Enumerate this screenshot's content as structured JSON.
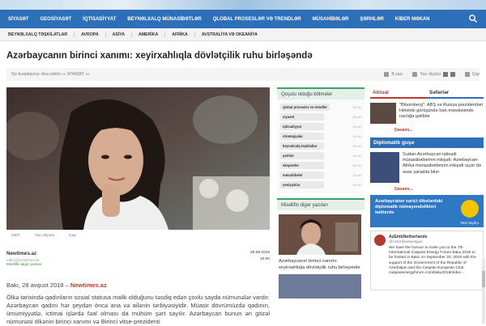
{
  "nav": {
    "items": [
      "SİYASƏT",
      "GEOSİYASƏT",
      "İQTİSADİYYAT",
      "BEYNƏLXALQ MÜNASİBƏTLƏR",
      "QLOBAL PROSESLƏR VƏ TRENDLƏR",
      "MÜSAHİBƏLƏR",
      "ŞƏRHLƏR",
      "KİBER MƏKAN"
    ]
  },
  "subnav": {
    "items": [
      "BEYNƏLXALQ TƏŞKİLATLAR",
      "AVROPA",
      "ASİYA",
      "AMERİKA",
      "AFRİKA",
      "AVSTRALİYA VƏ OKEANİYA"
    ]
  },
  "article": {
    "title": "Azərbaycanın birinci xanımı: xeyirxahlıqla dövlətçilik ruhu birləşəndə",
    "breadcrumb": "Siz buradasınız: Ana səhifə »» SİYASƏT »»",
    "tools": [
      "B yazı",
      "Yazı ölçüsü",
      "Çap"
    ],
    "stats": [
      "3407",
      "Yazı ölçüsü",
      "Çap"
    ],
    "source_name": "Newtimes.az",
    "source_email": "editor@newtimes.az",
    "source_link": "Müəllifin digər yazıları",
    "date": "28.08.2018",
    "time": "10:00",
    "lead_prefix": "Bakı, 28 avqust 2018 –",
    "lead_source": "Newtimes.az",
    "body": "Ölkə tarixində qadınların sosial statusa malik olduğunu təsdiq edən çoxlu sayda nümunələr vardır. Azərbaycan qadını hər şeydən öncə ana və ailənin tərbiyəsiyidir. Müasir dövrümüzdə qadının, ümumiyyətlə, ictimai işlərdə fəal olması da mühüm şərt sayılır. Azərbaycan bunun ən gözəl nümunəsi ölkənin birinci xanımı və Birinci vitse-prezidenti"
  },
  "sidebar_mid": {
    "categories_title": "Qoşulu olduğu bölmələr",
    "categories": [
      {
        "name": "qlobal proseslər və trendlər",
        "more": "Ətraflı"
      },
      {
        "name": "siyasət",
        "more": "Ətraflı"
      },
      {
        "name": "iqtisadiyyat",
        "more": "Ətraflı"
      },
      {
        "name": "strateqiyalar",
        "more": "Ətraflı"
      },
      {
        "name": "beynəlxalq təşkilatlar",
        "more": "Ətraflı"
      },
      {
        "name": "şərhlər",
        "more": "Ətraflı"
      },
      {
        "name": "ekspertlər",
        "more": "Ətraflı"
      },
      {
        "name": "müsahibələr",
        "more": "Ətraflı"
      },
      {
        "name": "yeniyazılar",
        "more": "Ətraflı"
      }
    ],
    "author_posts_title": "Müəllifin digər yazıları",
    "author_post_text": "Azərbaycanın birinci xanımı: xeyirxahlıqla dövlətçilik ruhu birləşəndə"
  },
  "sidebar_right": {
    "tab_actual": "Aktual",
    "tab_trips": "Səfərlər",
    "news": [
      {
        "text": "\"Bloomberg\": ABŞ və Rusiya prezidentləri Helsinki görüşündə İran məsələsinde razılığa gəliblər"
      }
    ],
    "more": "Davamı...",
    "dip_title": "Diplomatik guşə",
    "dip_news": [
      {
        "text": "Sudan-Azərbaycan iqtisadi münasibətlərinin inkişafı: Azərbaycan-Afrika münasibətlərinin inkişafı üçün də əsas yaradıla bilər"
      }
    ],
    "dip_more": "Davamı...",
    "promo_text": "Azərbaycanın xarici ölkələrdəki diplomatik nümayəndəlikləri twitterdə",
    "promo_tag": "Yeni layihə",
    "tweet_name": "AzEmbNetherlands",
    "tweet_handle": "@AzEmbassyHague",
    "tweet_body": "We have the honour to invite you to the 7th International Caspian Energy Forum Baku 2018 to be hosted in Baku on September 20, 2018 with the support of the Government of the Republic of Azerbaijan and the Caspian European Club. caspianenergyforum.com/baku2018/index..."
  },
  "colors": {
    "nav": "#2d6fb8",
    "accent_green": "#3aa36a",
    "accent_red": "#c0392b"
  }
}
